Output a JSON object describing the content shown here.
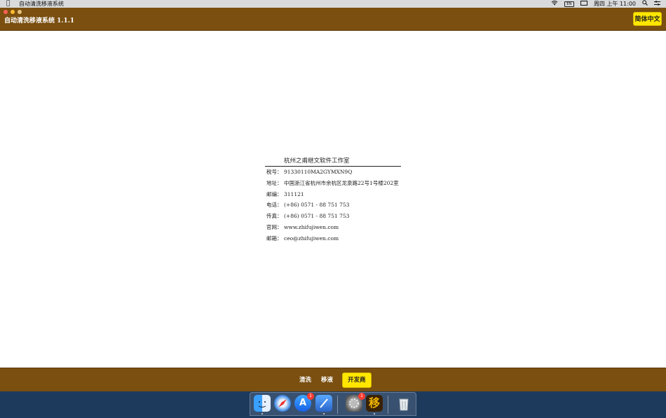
{
  "menubar": {
    "app_name": "自动清洗移液系统",
    "clock": "周四 上午 11:00",
    "input_method": "EN"
  },
  "window": {
    "title": "自动清洗移液系统 1.1.1",
    "language_button": "简体中文"
  },
  "company": {
    "name": "杭州之甫继文软件工作室",
    "rows": [
      {
        "label": "税号：",
        "value": "91330110MA2GYMXN9Q"
      },
      {
        "label": "地址：",
        "value": "中国浙江省杭州市余杭区龙泉路22号1号楼202室"
      },
      {
        "label": "邮编：",
        "value": "311121"
      },
      {
        "label": "电话：",
        "value": "(+86) 0571 - 88 751 753"
      },
      {
        "label": "传真：",
        "value": "(+86) 0571 - 88 751 753"
      },
      {
        "label": "官网：",
        "value": "www.zhifujiwen.com"
      },
      {
        "label": "邮箱：",
        "value": "ceo@zhifujiwen.com"
      }
    ]
  },
  "tabs": [
    {
      "label": "清洗",
      "active": false
    },
    {
      "label": "移液",
      "active": false
    },
    {
      "label": "开发商",
      "active": true
    }
  ],
  "dock": {
    "items": [
      {
        "icon": "finder-icon",
        "badge": ""
      },
      {
        "icon": "safari-icon",
        "badge": ""
      },
      {
        "icon": "app-store-icon",
        "badge": "1"
      },
      {
        "icon": "xcode-icon",
        "badge": ""
      },
      {
        "icon": "system-preferences-icon",
        "badge": "1"
      },
      {
        "icon": "app-icon",
        "glyph": "移"
      },
      {
        "icon": "trash-icon",
        "badge": ""
      }
    ]
  },
  "colors": {
    "bar_brown": "#7a4f10",
    "accent_yellow": "#ffe600"
  }
}
